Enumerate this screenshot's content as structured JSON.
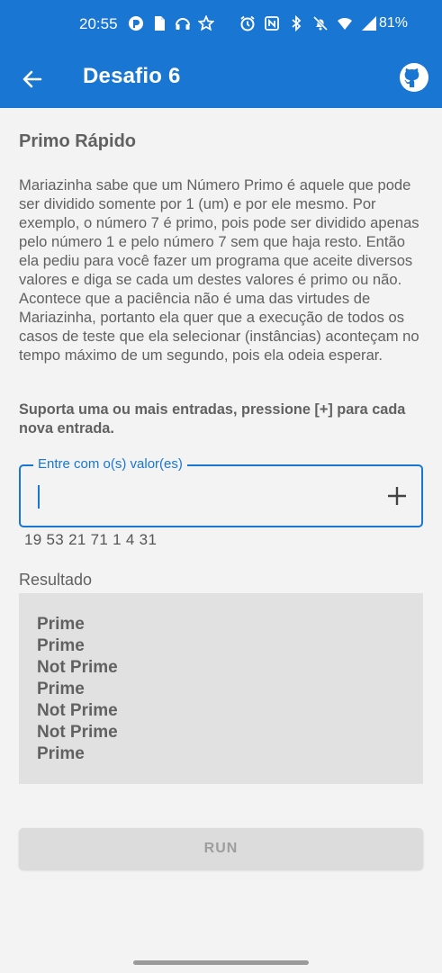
{
  "status_bar": {
    "time": "20:55",
    "battery": "81%",
    "left_icons": [
      "app-notification-icon",
      "document-icon",
      "headphones-icon",
      "star-icon"
    ],
    "right_icons": [
      "alarm-icon",
      "nfc-icon",
      "bluetooth-icon",
      "mute-icon",
      "wifi-icon",
      "signal-icon"
    ]
  },
  "app_bar": {
    "title": "Desafio 6",
    "back_icon": "arrow-left-icon",
    "action_icon": "github-icon",
    "background": "#1976d2"
  },
  "challenge": {
    "title": "Primo Rápido",
    "description": "Mariazinha sabe que um Número Primo é aquele que pode ser dividido somente por 1 (um) e por ele mesmo. Por exemplo, o número 7 é primo, pois pode ser dividido apenas pelo número 1 e pelo número 7 sem que haja resto. Então ela pediu para você fazer um programa que aceite diversos valores e diga se cada um destes valores é primo ou não. Acontece que a paciência não é uma das virtudes de Mariazinha, portanto ela quer que a execução de todos os casos de teste que ela selecionar (instâncias) aconteçam no tempo máximo de um segundo, pois ela odeia esperar.",
    "hint": "Suporta uma ou mais entradas, pressione [+] para cada nova entrada."
  },
  "input": {
    "label": "Entre com o(s) valor(es)",
    "value": "",
    "add_icon": "plus-icon",
    "entered_values": "19 53 21 71 1 4 31"
  },
  "result": {
    "label": "Resultado",
    "lines": [
      "Prime",
      "Prime",
      "Not Prime",
      "Prime",
      "Not Prime",
      "Not Prime",
      "Prime"
    ]
  },
  "run_button": {
    "label": "RUN"
  }
}
